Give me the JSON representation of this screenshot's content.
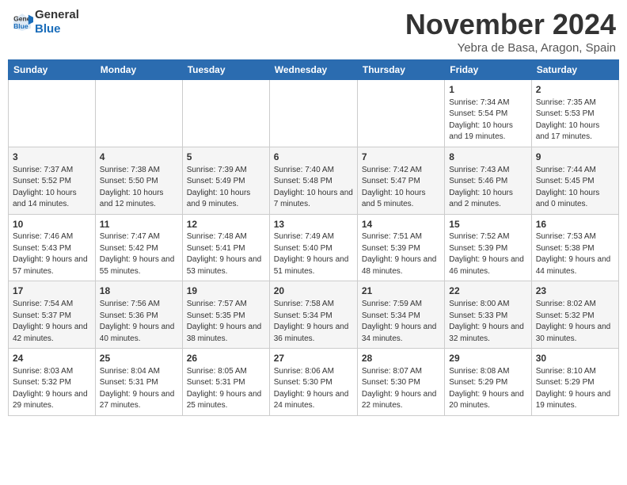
{
  "header": {
    "logo_line1": "General",
    "logo_line2": "Blue",
    "month": "November 2024",
    "location": "Yebra de Basa, Aragon, Spain"
  },
  "weekdays": [
    "Sunday",
    "Monday",
    "Tuesday",
    "Wednesday",
    "Thursday",
    "Friday",
    "Saturday"
  ],
  "weeks": [
    {
      "row": 1,
      "days": [
        {
          "date": "",
          "info": ""
        },
        {
          "date": "",
          "info": ""
        },
        {
          "date": "",
          "info": ""
        },
        {
          "date": "",
          "info": ""
        },
        {
          "date": "",
          "info": ""
        },
        {
          "date": "1",
          "info": "Sunrise: 7:34 AM\nSunset: 5:54 PM\nDaylight: 10 hours and 19 minutes."
        },
        {
          "date": "2",
          "info": "Sunrise: 7:35 AM\nSunset: 5:53 PM\nDaylight: 10 hours and 17 minutes."
        }
      ]
    },
    {
      "row": 2,
      "days": [
        {
          "date": "3",
          "info": "Sunrise: 7:37 AM\nSunset: 5:52 PM\nDaylight: 10 hours and 14 minutes."
        },
        {
          "date": "4",
          "info": "Sunrise: 7:38 AM\nSunset: 5:50 PM\nDaylight: 10 hours and 12 minutes."
        },
        {
          "date": "5",
          "info": "Sunrise: 7:39 AM\nSunset: 5:49 PM\nDaylight: 10 hours and 9 minutes."
        },
        {
          "date": "6",
          "info": "Sunrise: 7:40 AM\nSunset: 5:48 PM\nDaylight: 10 hours and 7 minutes."
        },
        {
          "date": "7",
          "info": "Sunrise: 7:42 AM\nSunset: 5:47 PM\nDaylight: 10 hours and 5 minutes."
        },
        {
          "date": "8",
          "info": "Sunrise: 7:43 AM\nSunset: 5:46 PM\nDaylight: 10 hours and 2 minutes."
        },
        {
          "date": "9",
          "info": "Sunrise: 7:44 AM\nSunset: 5:45 PM\nDaylight: 10 hours and 0 minutes."
        }
      ]
    },
    {
      "row": 3,
      "days": [
        {
          "date": "10",
          "info": "Sunrise: 7:46 AM\nSunset: 5:43 PM\nDaylight: 9 hours and 57 minutes."
        },
        {
          "date": "11",
          "info": "Sunrise: 7:47 AM\nSunset: 5:42 PM\nDaylight: 9 hours and 55 minutes."
        },
        {
          "date": "12",
          "info": "Sunrise: 7:48 AM\nSunset: 5:41 PM\nDaylight: 9 hours and 53 minutes."
        },
        {
          "date": "13",
          "info": "Sunrise: 7:49 AM\nSunset: 5:40 PM\nDaylight: 9 hours and 51 minutes."
        },
        {
          "date": "14",
          "info": "Sunrise: 7:51 AM\nSunset: 5:39 PM\nDaylight: 9 hours and 48 minutes."
        },
        {
          "date": "15",
          "info": "Sunrise: 7:52 AM\nSunset: 5:39 PM\nDaylight: 9 hours and 46 minutes."
        },
        {
          "date": "16",
          "info": "Sunrise: 7:53 AM\nSunset: 5:38 PM\nDaylight: 9 hours and 44 minutes."
        }
      ]
    },
    {
      "row": 4,
      "days": [
        {
          "date": "17",
          "info": "Sunrise: 7:54 AM\nSunset: 5:37 PM\nDaylight: 9 hours and 42 minutes."
        },
        {
          "date": "18",
          "info": "Sunrise: 7:56 AM\nSunset: 5:36 PM\nDaylight: 9 hours and 40 minutes."
        },
        {
          "date": "19",
          "info": "Sunrise: 7:57 AM\nSunset: 5:35 PM\nDaylight: 9 hours and 38 minutes."
        },
        {
          "date": "20",
          "info": "Sunrise: 7:58 AM\nSunset: 5:34 PM\nDaylight: 9 hours and 36 minutes."
        },
        {
          "date": "21",
          "info": "Sunrise: 7:59 AM\nSunset: 5:34 PM\nDaylight: 9 hours and 34 minutes."
        },
        {
          "date": "22",
          "info": "Sunrise: 8:00 AM\nSunset: 5:33 PM\nDaylight: 9 hours and 32 minutes."
        },
        {
          "date": "23",
          "info": "Sunrise: 8:02 AM\nSunset: 5:32 PM\nDaylight: 9 hours and 30 minutes."
        }
      ]
    },
    {
      "row": 5,
      "days": [
        {
          "date": "24",
          "info": "Sunrise: 8:03 AM\nSunset: 5:32 PM\nDaylight: 9 hours and 29 minutes."
        },
        {
          "date": "25",
          "info": "Sunrise: 8:04 AM\nSunset: 5:31 PM\nDaylight: 9 hours and 27 minutes."
        },
        {
          "date": "26",
          "info": "Sunrise: 8:05 AM\nSunset: 5:31 PM\nDaylight: 9 hours and 25 minutes."
        },
        {
          "date": "27",
          "info": "Sunrise: 8:06 AM\nSunset: 5:30 PM\nDaylight: 9 hours and 24 minutes."
        },
        {
          "date": "28",
          "info": "Sunrise: 8:07 AM\nSunset: 5:30 PM\nDaylight: 9 hours and 22 minutes."
        },
        {
          "date": "29",
          "info": "Sunrise: 8:08 AM\nSunset: 5:29 PM\nDaylight: 9 hours and 20 minutes."
        },
        {
          "date": "30",
          "info": "Sunrise: 8:10 AM\nSunset: 5:29 PM\nDaylight: 9 hours and 19 minutes."
        }
      ]
    }
  ]
}
